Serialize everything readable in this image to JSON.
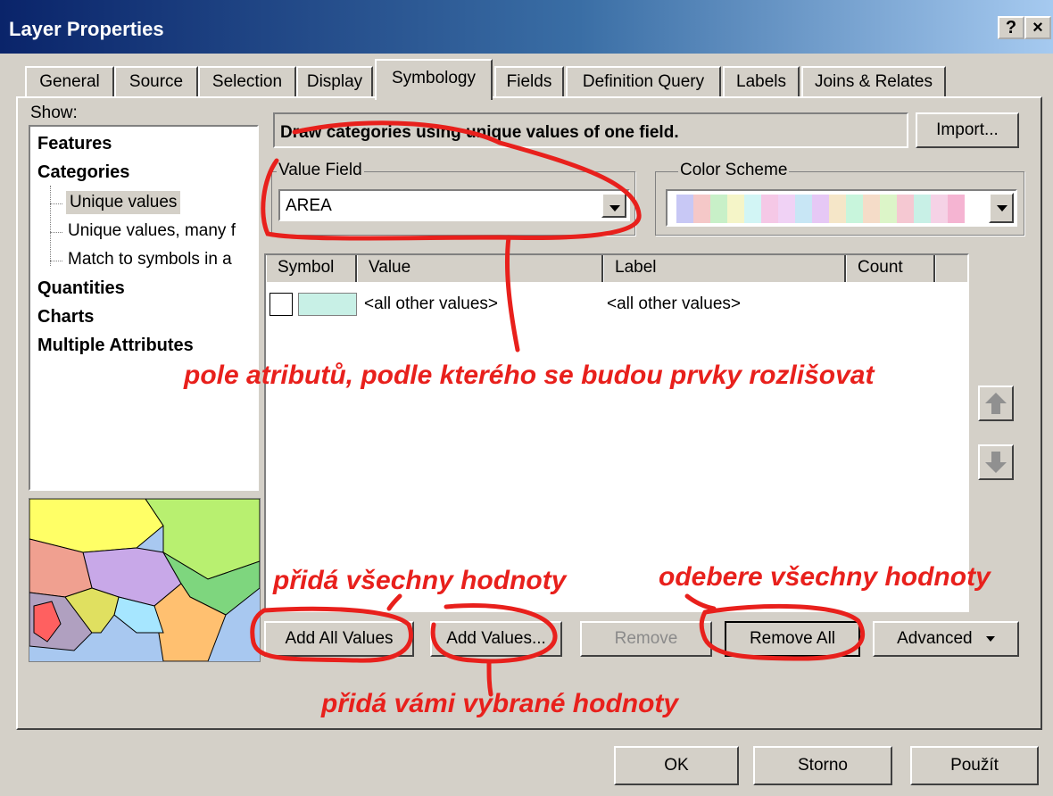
{
  "window": {
    "title": "Layer Properties",
    "help_label": "?",
    "close_label": "×"
  },
  "tabs": [
    "General",
    "Source",
    "Selection",
    "Display",
    "Symbology",
    "Fields",
    "Definition Query",
    "Labels",
    "Joins & Relates"
  ],
  "active_tab": "Symbology",
  "show": {
    "label": "Show:",
    "items": [
      "Features",
      "Categories",
      "Unique values",
      "Unique values, many f",
      "Match to symbols in a",
      "Quantities",
      "Charts",
      "Multiple Attributes"
    ]
  },
  "description": "Draw categories using unique values of one field.",
  "import_label": "Import...",
  "value_field": {
    "label": "Value Field",
    "value": "AREA"
  },
  "color_scheme": {
    "label": "Color Scheme",
    "colors": [
      "#c8c8f5",
      "#f5c8c8",
      "#c8f0c8",
      "#f5f5c8",
      "#d2f5f5",
      "#f5c8e6",
      "#f0d2f5",
      "#c8e6f5",
      "#e6c8f5",
      "#f5e6c8",
      "#c8f5dc",
      "#f5dcc8",
      "#dcf5c8",
      "#f5c8d2",
      "#c8f0e6",
      "#f5d2e6",
      "#f5b4d2"
    ]
  },
  "table": {
    "columns": [
      "Symbol",
      "Value",
      "Label",
      "Count"
    ],
    "rows": [
      {
        "symbol_color": "#c8f0e6",
        "value": "<all other values>",
        "label": "<all other values>",
        "count": ""
      }
    ]
  },
  "buttons": {
    "add_all_values": "Add All Values",
    "add_values": "Add Values...",
    "remove": "Remove",
    "remove_all": "Remove All",
    "advanced": "Advanced"
  },
  "dialog_buttons": {
    "ok": "OK",
    "cancel": "Storno",
    "apply": "Použít"
  },
  "annotations": {
    "value_field_note": "pole atributů, podle kterého se budou prvky rozlišovat",
    "add_all_note": "přidá všechny hodnoty",
    "remove_all_note": "odebere všechny hodnoty",
    "add_values_note": "přidá vámi vybrané hodnoty"
  },
  "colors": {
    "annotation": "#e8201c",
    "title_bar": "#0a246a",
    "tree_selected": "#d4d0c8"
  }
}
